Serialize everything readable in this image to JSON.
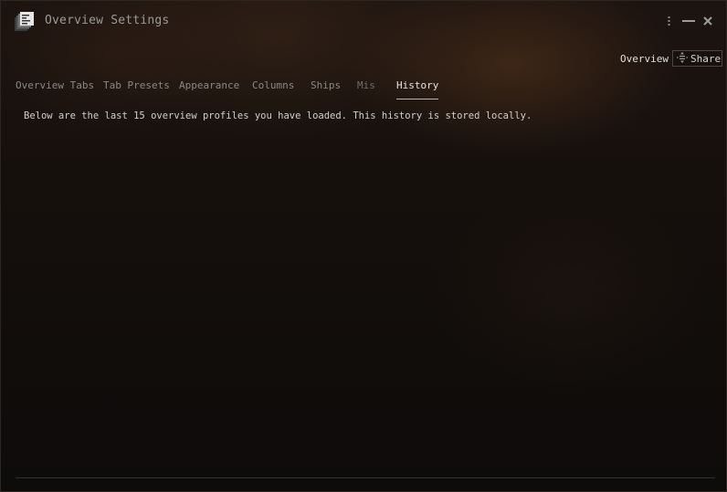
{
  "window": {
    "title": "Overview Settings",
    "icon": "overview-settings-icon",
    "controls": {
      "menu_icon": "kebab-menu-icon",
      "minimize_icon": "minimize-icon",
      "close_icon": "close-icon",
      "menu_glyph": "⋮",
      "minimize_glyph": "—",
      "close_glyph": "✕"
    }
  },
  "header": {
    "profile_label": "Overview",
    "share_button": {
      "label": "Share",
      "icon": "share-icon"
    }
  },
  "tabs": [
    {
      "label": "Overview Tabs",
      "active": false
    },
    {
      "label": "Tab Presets",
      "active": false
    },
    {
      "label": "Appearance",
      "active": false
    },
    {
      "label": "Columns",
      "active": false
    },
    {
      "label": "Ships",
      "active": false
    },
    {
      "label": "Misc",
      "active": false
    },
    {
      "label": "History",
      "active": true
    }
  ],
  "history": {
    "description": "Below are the last 15 overview profiles you have loaded. This history is stored locally."
  },
  "colors": {
    "active_tab_text": "#e4e4e2",
    "inactive_tab_text": "#8a8886",
    "background": "#0e0c0b"
  }
}
